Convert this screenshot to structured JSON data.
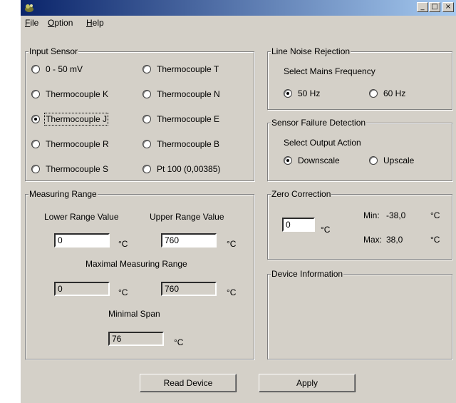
{
  "menu": {
    "file": "File",
    "option": "Option",
    "help": "Help"
  },
  "input_sensor": {
    "title": "Input Sensor",
    "options": [
      {
        "label": "0 - 50 mV",
        "checked": false
      },
      {
        "label": "Thermocouple T",
        "checked": false
      },
      {
        "label": "Thermocouple K",
        "checked": false
      },
      {
        "label": "Thermocouple N",
        "checked": false
      },
      {
        "label": "Thermocouple J",
        "checked": true
      },
      {
        "label": "Thermocouple E",
        "checked": false
      },
      {
        "label": "Thermocouple R",
        "checked": false
      },
      {
        "label": "Thermocouple B",
        "checked": false
      },
      {
        "label": "Thermocouple S",
        "checked": false
      },
      {
        "label": "Pt 100 (0,00385)",
        "checked": false
      }
    ]
  },
  "line_noise": {
    "title": "Line Noise Rejection",
    "caption": "Select Mains Frequency",
    "options": [
      {
        "label": "50 Hz",
        "checked": true
      },
      {
        "label": "60 Hz",
        "checked": false
      }
    ]
  },
  "sensor_failure": {
    "title": "Sensor Failure Detection",
    "caption": "Select Output Action",
    "options": [
      {
        "label": "Downscale",
        "checked": true
      },
      {
        "label": "Upscale",
        "checked": false
      }
    ]
  },
  "measuring_range": {
    "title": "Measuring Range",
    "lower_label": "Lower Range Value",
    "upper_label": "Upper Range Value",
    "lower_value": "0",
    "upper_value": "760",
    "maximal_label": "Maximal Measuring Range",
    "max_lower_value": "0",
    "max_upper_value": "760",
    "minimal_span_label": "Minimal Span",
    "minimal_span_value": "76",
    "unit": "°C"
  },
  "zero_correction": {
    "title": "Zero Correction",
    "value": "0",
    "unit": "°C",
    "min_label": "Min:",
    "min_value": "-38,0",
    "max_label": "Max:",
    "max_value": "38,0"
  },
  "device_info": {
    "title": "Device Information"
  },
  "buttons": {
    "read_device": "Read Device",
    "apply": "Apply"
  },
  "titlebar": {
    "minimize": "_",
    "maximize": "□",
    "close": "×"
  },
  "colors": {
    "title_start": "#0a246a",
    "title_end": "#a6caf0",
    "face": "#d4d0c8"
  }
}
